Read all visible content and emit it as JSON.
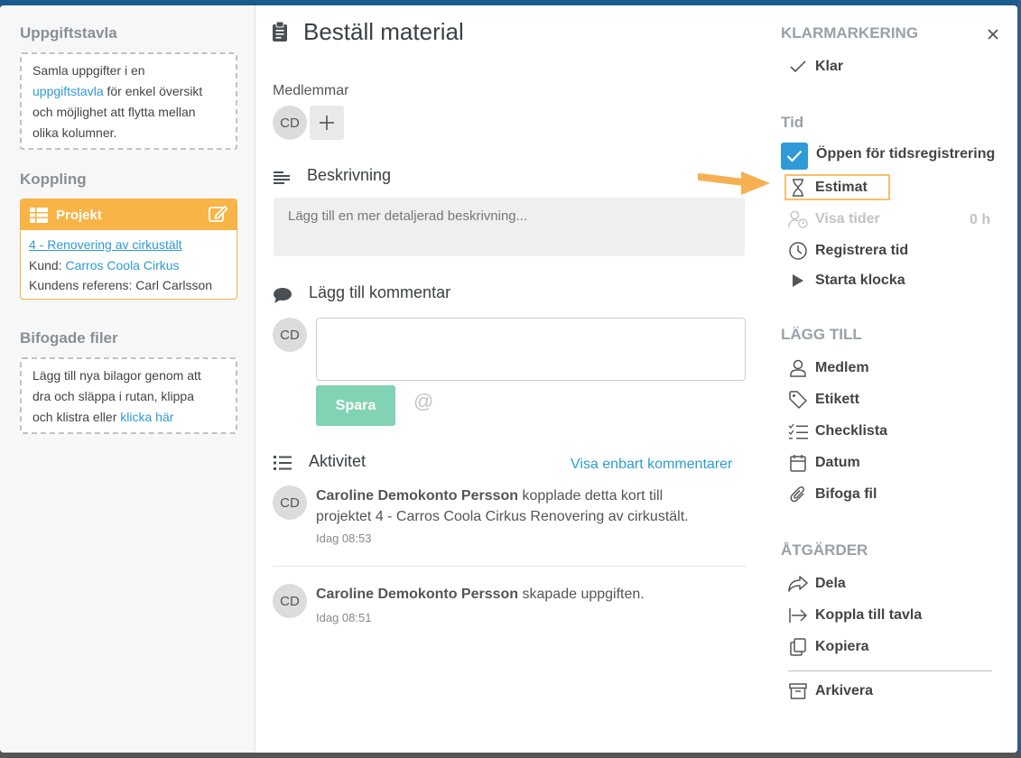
{
  "left": {
    "board_title": "Uppgiftstavla",
    "board_text_1": "Samla uppgifter i en",
    "board_link": "uppgiftstavla",
    "board_text_2": "för enkel översikt",
    "board_text_3": "och möjlighet att flytta mellan",
    "board_text_4": "olika kolumner.",
    "connection_title": "Koppling",
    "project": {
      "header": "Projekt",
      "name": "4 - Renovering av cirkustält",
      "customer_label": "Kund:",
      "customer": "Carros Coola Cirkus",
      "reference_label": "Kundens referens:",
      "reference": "Carl Carlsson"
    },
    "files_title": "Bifogade filer",
    "files_text_1": "Lägg till nya bilagor genom att",
    "files_text_2": "dra och släppa i rutan, klippa",
    "files_text_3": "och klistra eller",
    "files_link": "klicka här"
  },
  "main": {
    "title": "Beställ material",
    "members_label": "Medlemmar",
    "member_initials": "CD",
    "description_title": "Beskrivning",
    "description_placeholder": "Lägg till en mer detaljerad beskrivning...",
    "comment_title": "Lägg till kommentar",
    "commenter_initials": "CD",
    "save_label": "Spara",
    "at_symbol": "@",
    "activity_title": "Aktivitet",
    "show_comments_link": "Visa enbart kommentarer",
    "activities": [
      {
        "initials": "CD",
        "author": "Caroline Demokonto Persson",
        "text_1": "kopplade detta kort till",
        "text_2": "projektet 4 - Carros Coola Cirkus  Renovering av cirkustält.",
        "time": "Idag 08:53"
      },
      {
        "initials": "CD",
        "author": "Caroline Demokonto Persson",
        "text_1": "skapade uppgiften.",
        "time": "Idag 08:51"
      }
    ]
  },
  "right": {
    "done_section": "KLARMARKERING",
    "done_label": "Klar",
    "time_section": "Tid",
    "time_reg_label": "Öppen för tidsregistrering",
    "time_reg_checked": true,
    "estimate_label": "Estimat",
    "show_times_label": "Visa tider",
    "show_times_value": "0 h",
    "register_time_label": "Registrera tid",
    "start_clock_label": "Starta klocka",
    "add_section": "LÄGG TILL",
    "member_label": "Medlem",
    "label_label": "Etikett",
    "checklist_label": "Checklista",
    "date_label": "Datum",
    "attach_label": "Bifoga fil",
    "actions_section": "ÅTGÄRDER",
    "share_label": "Dela",
    "connect_label": "Koppla till tavla",
    "copy_label": "Kopiera",
    "archive_label": "Arkivera"
  },
  "colors": {
    "accent_blue": "#2e9bd6",
    "project_orange": "#f8b446",
    "save_green": "#82d3b3",
    "highlight_orange": "#f8c06a"
  }
}
